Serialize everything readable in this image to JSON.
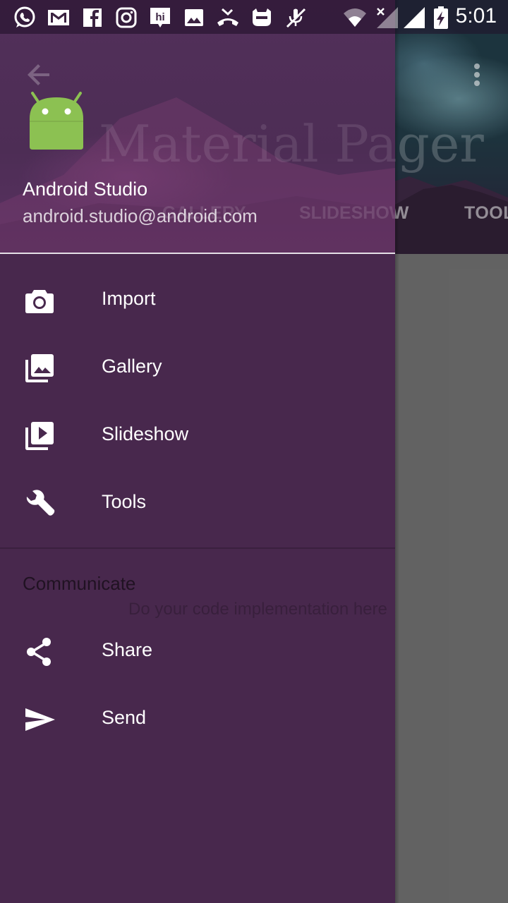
{
  "status_bar": {
    "time": "5:01",
    "left_icons": [
      "whatsapp-icon",
      "gmail-icon",
      "facebook-icon",
      "instagram-icon",
      "hike-icon",
      "image-icon",
      "missed-call-icon",
      "cyanogen-icon",
      "mute-mic-icon"
    ],
    "right_icons": [
      "wifi-icon",
      "no-signal-icon",
      "signal-icon",
      "battery-charging-icon"
    ]
  },
  "background_app": {
    "title": "Material Pager",
    "tabs": [
      "GALLERY",
      "SLIDESHOW",
      "TOOLS"
    ],
    "body_text": "Do your code implementation here"
  },
  "drawer": {
    "header": {
      "logo": "android-logo",
      "name": "Android Studio",
      "email": "android.studio@android.com"
    },
    "items": [
      {
        "label": "Import",
        "icon": "camera-icon"
      },
      {
        "label": "Gallery",
        "icon": "gallery-icon"
      },
      {
        "label": "Slideshow",
        "icon": "slideshow-icon"
      },
      {
        "label": "Tools",
        "icon": "wrench-icon"
      }
    ],
    "section": {
      "title": "Communicate",
      "items": [
        {
          "label": "Share",
          "icon": "share-icon"
        },
        {
          "label": "Send",
          "icon": "send-icon"
        }
      ]
    }
  },
  "colors": {
    "drawer_bg": "#48284d",
    "android_green": "#8cc152",
    "text_white": "#ffffff"
  }
}
